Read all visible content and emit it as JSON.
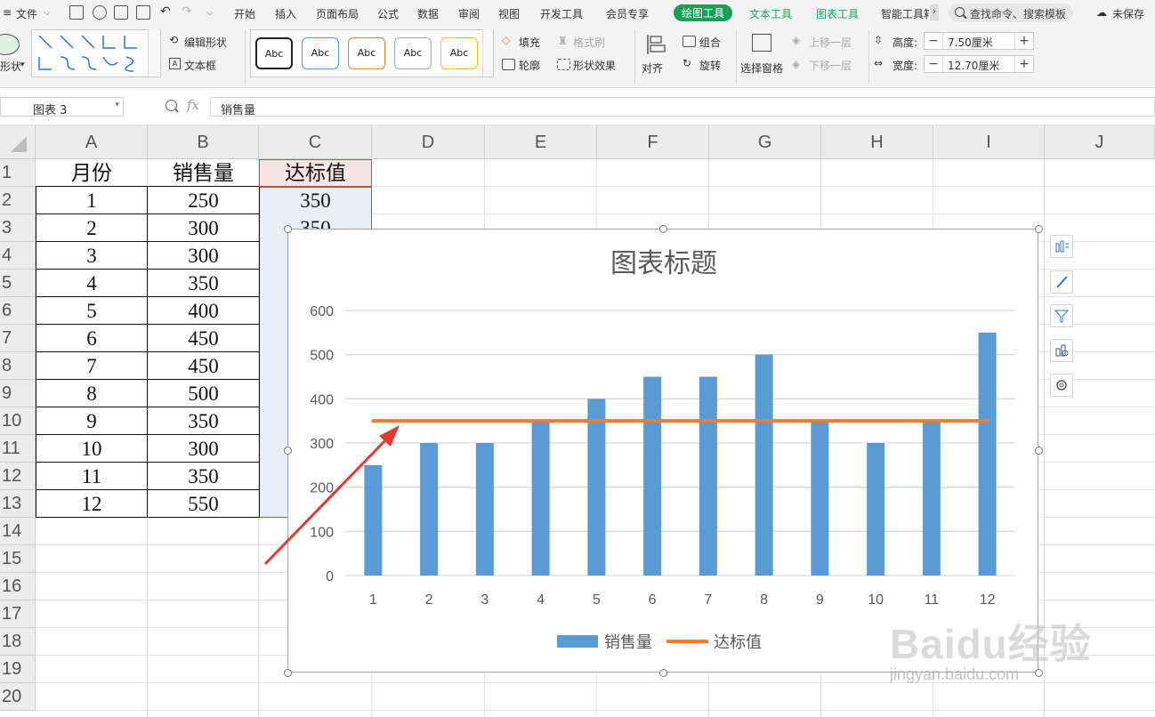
{
  "menubar": {
    "file": "文件",
    "tabs": [
      "开始",
      "插入",
      "页面布局",
      "公式",
      "数据",
      "审阅",
      "视图",
      "开发工具",
      "会员专享"
    ],
    "active_tab": "绘图工具",
    "text_tool": "文本工具",
    "chart_tool": "图表工具",
    "smart_tool": "智能工具箱",
    "search": "查找命令、搜索模板",
    "unsaved": "未保存"
  },
  "ribbon": {
    "shape": "形状",
    "edit_shape": "编辑形状",
    "text_box": "文本框",
    "style_label": "Abc",
    "fill": "填充",
    "format_brush": "格式刷",
    "outline": "轮廓",
    "shape_effect": "形状效果",
    "align": "对齐",
    "group": "组合",
    "rotate": "旋转",
    "selection_pane": "选择窗格",
    "bring_forward": "上移一层",
    "send_backward": "下移一层",
    "height_label": "高度:",
    "height_value": "7.50厘米",
    "width_label": "宽度:",
    "width_value": "12.70厘米"
  },
  "formula_bar": {
    "name_box": "图表 3",
    "fx": "fx",
    "content": "销售量"
  },
  "sheet": {
    "columns": [
      "A",
      "B",
      "C",
      "D",
      "E",
      "F",
      "G",
      "H",
      "I",
      "J"
    ],
    "rows": [
      "1",
      "2",
      "3",
      "4",
      "5",
      "6",
      "7",
      "8",
      "9",
      "10",
      "11",
      "12",
      "13",
      "14",
      "15",
      "16",
      "17",
      "18",
      "19",
      "20"
    ],
    "headers": [
      "月份",
      "销售量",
      "达标值"
    ],
    "months": [
      "1",
      "2",
      "3",
      "4",
      "5",
      "6",
      "7",
      "8",
      "9",
      "10",
      "11",
      "12"
    ],
    "sales": [
      "250",
      "300",
      "300",
      "350",
      "400",
      "450",
      "450",
      "500",
      "350",
      "300",
      "350",
      "550"
    ],
    "target_visible": [
      "350",
      "350"
    ]
  },
  "colors": {
    "accent_green": "#18a058",
    "bar": "#5b9bd5",
    "line": "#ed7d31",
    "arrow": "#e53935",
    "selection": "#e8edf8"
  },
  "chart_data": {
    "type": "bar",
    "title": "图表标题",
    "categories": [
      "1",
      "2",
      "3",
      "4",
      "5",
      "6",
      "7",
      "8",
      "9",
      "10",
      "11",
      "12"
    ],
    "ylim": [
      0,
      600
    ],
    "yticks": [
      0,
      100,
      200,
      300,
      400,
      500,
      600
    ],
    "grid": true,
    "legend": "bottom",
    "series": [
      {
        "name": "销售量",
        "type": "bar",
        "values": [
          250,
          300,
          300,
          350,
          400,
          450,
          450,
          500,
          350,
          300,
          350,
          550
        ]
      },
      {
        "name": "达标值",
        "type": "line",
        "values": [
          350,
          350,
          350,
          350,
          350,
          350,
          350,
          350,
          350,
          350,
          350,
          350
        ]
      }
    ]
  },
  "watermark": {
    "text": "Baidu经验",
    "url": "jingyan.baidu.com"
  }
}
